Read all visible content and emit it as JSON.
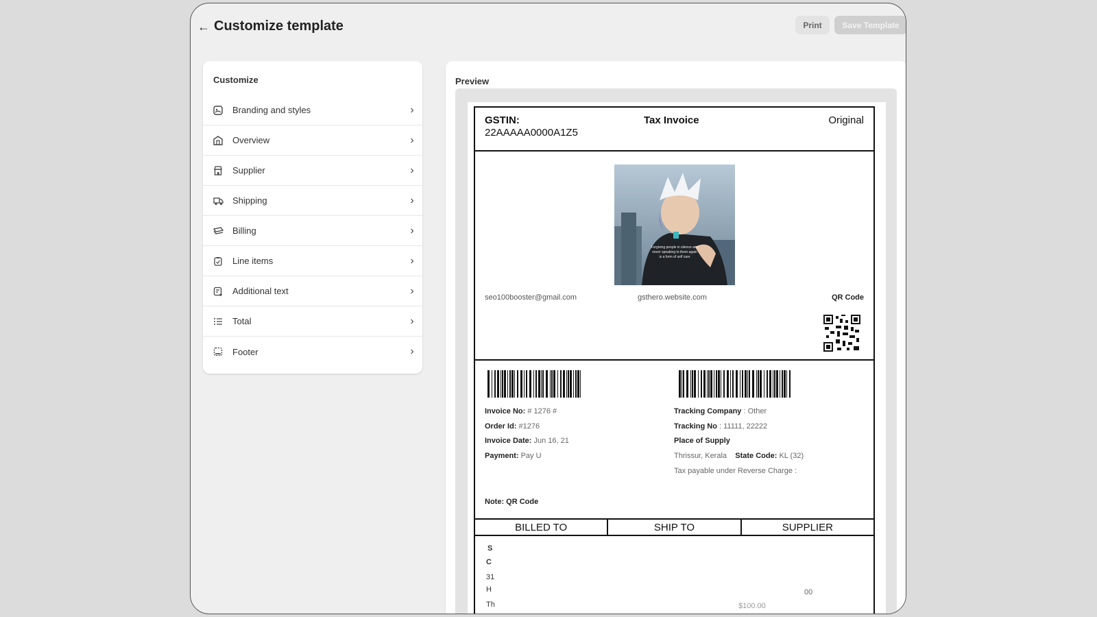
{
  "header": {
    "title": "Customize template",
    "print_label": "Print",
    "save_label": "Save Template"
  },
  "customize": {
    "title": "Customize",
    "items": [
      {
        "label": "Branding and styles",
        "icon": "palette-icon"
      },
      {
        "label": "Overview",
        "icon": "building-icon"
      },
      {
        "label": "Supplier",
        "icon": "store-icon"
      },
      {
        "label": "Shipping",
        "icon": "truck-icon"
      },
      {
        "label": "Billing",
        "icon": "cash-icon"
      },
      {
        "label": "Line items",
        "icon": "clipboard-icon"
      },
      {
        "label": "Additional text",
        "icon": "note-add-icon"
      },
      {
        "label": "Total",
        "icon": "list-icon"
      },
      {
        "label": "Footer",
        "icon": "footer-icon"
      }
    ]
  },
  "preview": {
    "title": "Preview",
    "invoice": {
      "gstin_label": "GSTIN:",
      "gstin_value": "22AAAAA0000A1Z5",
      "doc_title": "Tax Invoice",
      "copy_label": "Original",
      "email": "seo100booster@gmail.com",
      "website": "gsthero.website.com",
      "qr_label": "QR Code",
      "invoice_no_label": "Invoice No:",
      "invoice_no_value": " # 1276 #",
      "order_id_label": "Order Id:",
      "order_id_value": " #1276",
      "invoice_date_label": "Invoice Date:",
      "invoice_date_value": " Jun 16, 21",
      "payment_label": "Payment:",
      "payment_value": " Pay U",
      "tracking_company_label": "Tracking Company",
      "tracking_company_value": " : Other",
      "tracking_no_label": "Tracking No",
      "tracking_no_value": " : 11111, 22222",
      "place_of_supply_label": "Place of Supply",
      "place_value": "Thrissur, Kerala",
      "state_code_label": "State Code:",
      "state_code_value": " KL (32)",
      "reverse_charge": "Tax payable under Reverse Charge :",
      "note": "Note: QR Code",
      "billed_to": "BILLED TO",
      "ship_to": "SHIP TO",
      "supplier": "SUPPLIER",
      "frag_1": "S",
      "frag_2": "C",
      "frag_3": "31",
      "frag_4": "H",
      "frag_5": "Th",
      "frag_6": "00",
      "frag_7": "$100.00"
    }
  }
}
